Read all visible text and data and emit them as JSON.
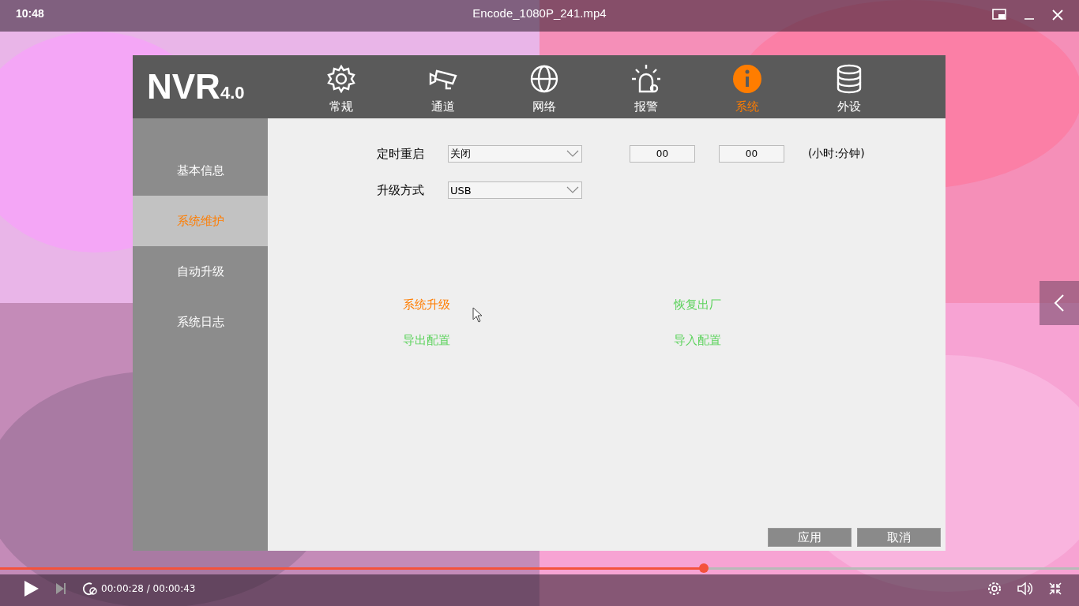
{
  "player": {
    "clock": "10:48",
    "title": "Encode_1080P_241.mp4",
    "time": "00:00:28 / 00:00:43",
    "progress": {
      "level": 0.652
    }
  },
  "nvr": {
    "logo": "NVR",
    "version": "4.0",
    "tabs": [
      {
        "label": "常规",
        "selected": false
      },
      {
        "label": "通道",
        "selected": false
      },
      {
        "label": "网络",
        "selected": false
      },
      {
        "label": "报警",
        "selected": false
      },
      {
        "label": "系统",
        "selected": true
      },
      {
        "label": "外设",
        "selected": false
      }
    ],
    "sidebar": [
      {
        "label": "基本信息",
        "selected": false
      },
      {
        "label": "系统维护",
        "selected": true
      },
      {
        "label": "自动升级",
        "selected": false
      },
      {
        "label": "系统日志",
        "selected": false
      }
    ],
    "form": {
      "reboot": {
        "label": "定时重启",
        "value": "关闭",
        "hour": "00",
        "minute": "00",
        "unit": "(小时:分钟)"
      },
      "upgrade": {
        "label": "升级方式",
        "value": "USB"
      }
    },
    "actions": [
      {
        "label": "系统升级",
        "selected": true
      },
      {
        "label": "恢复出厂",
        "selected": false
      },
      {
        "label": "导出配置",
        "selected": false
      },
      {
        "label": "导入配置",
        "selected": false
      }
    ],
    "buttons": [
      "应用",
      "取消"
    ]
  }
}
